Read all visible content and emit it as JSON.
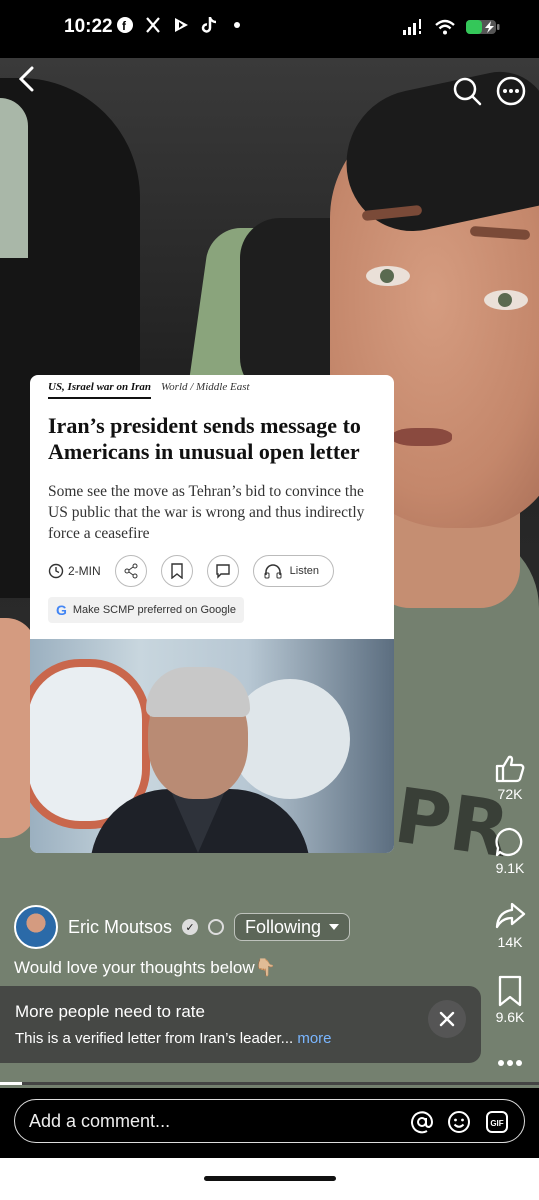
{
  "status_bar": {
    "time": "10:22",
    "left_icons": [
      "facebook-icon",
      "x-icon",
      "play-icon",
      "tiktok-icon"
    ],
    "signal_icon": "cellular-signal-icon",
    "wifi_icon": "wifi-icon",
    "battery_icon": "battery-charging-icon"
  },
  "top_bar": {
    "back_icon": "back-chevron-icon",
    "search_icon": "search-icon",
    "more_icon": "more-options-icon"
  },
  "article": {
    "tag_main": "US, Israel war on Iran",
    "tag_sub": "World / Middle East",
    "title": "Iran’s president sends message to Americans in unusual open letter",
    "description": "Some see the move as Tehran’s bid to convince the US public that the war is wrong and thus indirectly force a ceasefire",
    "read_time": "2-MIN",
    "listen_label": "Listen",
    "google_pill": "Make SCMP preferred on Google"
  },
  "rail": {
    "like_count": "72K",
    "comment_count": "9.1K",
    "share_count": "14K",
    "save_count": "9.6K"
  },
  "creator": {
    "name": "Eric Moutsos",
    "follow_label": "Following",
    "caption": "Would love your thoughts below👇🏼"
  },
  "rate_panel": {
    "title": "More people need to rate",
    "description": "This is a verified letter from Iran’s leader...",
    "more": "more"
  },
  "progress": {
    "fraction": 0.04
  },
  "comment": {
    "placeholder": "Add a comment...",
    "gif_label": "GIF"
  },
  "colors": {
    "link": "#7ab6ff",
    "background": "#000000"
  }
}
